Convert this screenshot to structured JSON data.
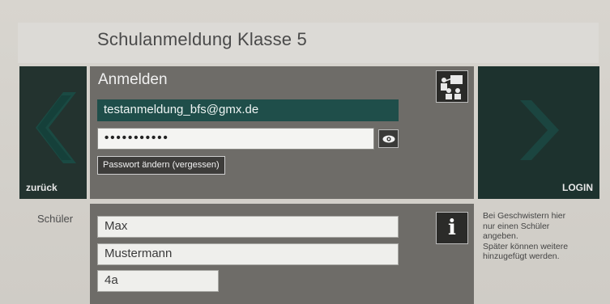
{
  "header": {
    "title": "Schulanmeldung Klasse 5"
  },
  "nav": {
    "back_label": "zurück",
    "login_label": "LOGIN"
  },
  "login": {
    "heading": "Anmelden",
    "email_value": "testanmeldung_bfs@gmx.de",
    "password_value": "•••••••••••",
    "change_password_label": "Passwort ändern (vergessen)"
  },
  "student": {
    "label": "Schüler",
    "first_name": "Max",
    "last_name": "Mustermann",
    "class": "4a"
  },
  "hint": {
    "line1": "Bei Geschwistern hier",
    "line2": "nur einen Schüler",
    "line3": "angeben.",
    "line4": "Später können weitere",
    "line5": "hinzugefügt werden."
  },
  "icons": {
    "back": "chevron-left-icon",
    "forward": "chevron-right-icon",
    "eye": "eye-icon",
    "teacher": "teacher-icon",
    "info": "info-icon"
  },
  "colors": {
    "panel": "#6e6c68",
    "dark_nav": "#23332f",
    "email_bg": "#1f4e4a",
    "chevron": "#1a3f39"
  }
}
